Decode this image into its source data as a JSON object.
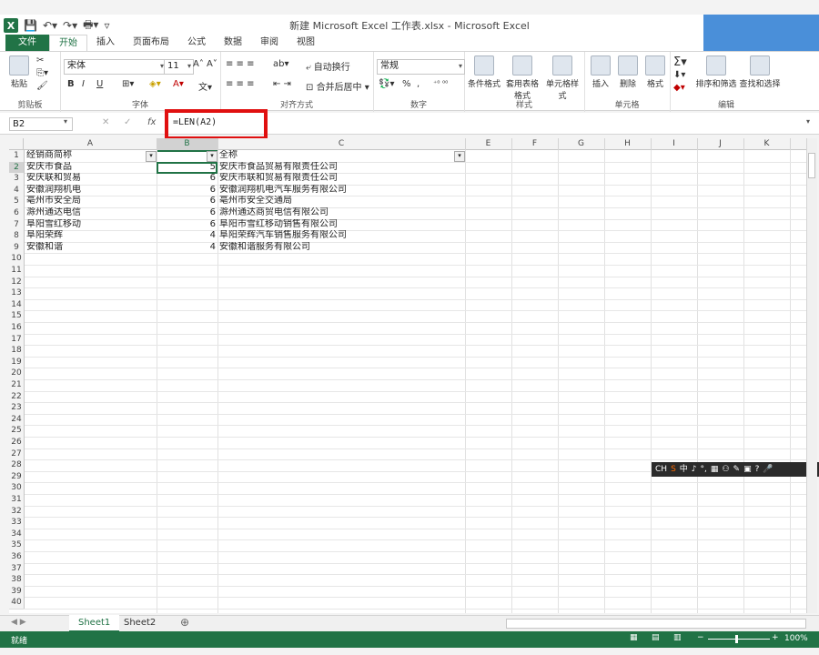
{
  "window": {
    "title": "新建 Microsoft Excel 工作表.xlsx - Microsoft Excel",
    "app_icon": "excel-icon"
  },
  "ribbon_tabs": [
    "文件",
    "开始",
    "插入",
    "页面布局",
    "公式",
    "数据",
    "审阅",
    "视图"
  ],
  "active_tab": "开始",
  "ribbon": {
    "clipboard": {
      "label": "剪贴板",
      "paste": "粘贴"
    },
    "font": {
      "label": "字体",
      "font_name": "宋体",
      "font_size": "11",
      "bold": "B",
      "italic": "I",
      "underline": "U"
    },
    "alignment": {
      "label": "对齐方式",
      "wrap": "自动换行",
      "merge": "合并后居中"
    },
    "number": {
      "label": "数字",
      "format": "常规",
      "percent": "%",
      "comma": ","
    },
    "styles": {
      "label": "样式",
      "cond": "条件格式",
      "table": "套用表格格式",
      "cell": "单元格样式"
    },
    "cells": {
      "label": "单元格",
      "insert": "插入",
      "delete": "删除",
      "format": "格式"
    },
    "editing": {
      "label": "编辑",
      "sort": "排序和筛选",
      "find": "查找和选择"
    }
  },
  "formula_bar": {
    "name_box": "B2",
    "fx": "fx",
    "formula": "=LEN(A2)"
  },
  "columns": [
    "A",
    "B",
    "C",
    "E",
    "F",
    "G",
    "H",
    "I",
    "J",
    "K"
  ],
  "active_column": "B",
  "active_row": 2,
  "rows": [
    {
      "a": "经销商简称",
      "b": "",
      "c": "全称"
    },
    {
      "a": "安庆市食品",
      "b": "5",
      "c": "安庆市食品贸易有限责任公司"
    },
    {
      "a": "安庆联和贸易",
      "b": "6",
      "c": "安庆市联和贸易有限责任公司"
    },
    {
      "a": "安徽润翔机电",
      "b": "6",
      "c": "安徽润翔机电汽车服务有限公司"
    },
    {
      "a": "亳州市安全局",
      "b": "6",
      "c": "亳州市安全交通局"
    },
    {
      "a": "滁州通达电信",
      "b": "6",
      "c": "滁州通达商贸电信有限公司"
    },
    {
      "a": "阜阳雪红移动",
      "b": "6",
      "c": "阜阳市雪红移动销售有限公司"
    },
    {
      "a": "阜阳荣辉",
      "b": "4",
      "c": "阜阳荣辉汽车销售服务有限公司"
    },
    {
      "a": "安徽和谐",
      "b": "4",
      "c": "安徽和谐服务有限公司"
    }
  ],
  "row_numbers": [
    "1",
    "2",
    "3",
    "4",
    "5",
    "6",
    "7",
    "8",
    "9",
    "10",
    "11",
    "12",
    "13",
    "14",
    "15",
    "16",
    "17",
    "18",
    "19",
    "20",
    "21",
    "22",
    "23",
    "24",
    "25",
    "26",
    "27",
    "28",
    "29",
    "30",
    "31",
    "32",
    "33",
    "34",
    "35",
    "36",
    "37",
    "38",
    "39",
    "40"
  ],
  "sheets": [
    "Sheet1",
    "Sheet2"
  ],
  "active_sheet": "Sheet1",
  "status": {
    "ready": "就绪",
    "zoom": "100%"
  },
  "ime_bar": [
    "CH",
    "S",
    "中",
    "♪",
    "°,",
    "▦",
    "⚇",
    "✎",
    "▣",
    "?",
    "🎤"
  ]
}
